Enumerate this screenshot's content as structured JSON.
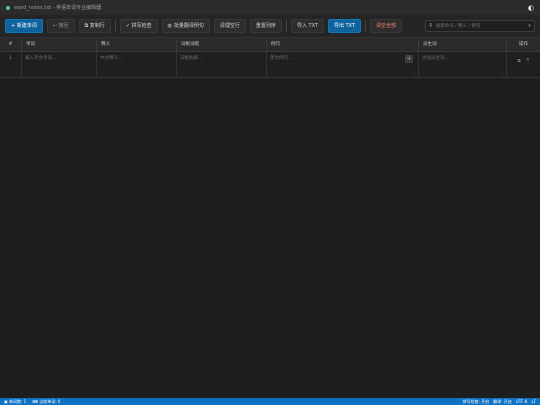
{
  "window": {
    "title": "word_notes.txt - 英语单词专业编辑器"
  },
  "toolbar": {
    "new_word": "+ 新建单词",
    "undo": "↩ 撤回",
    "copy_row": "⧉ 复制行",
    "spellcheck": "✓ 拼写检查",
    "batch_translate": "批量翻译例句",
    "clear_empty": "清理空行",
    "reorder": "重置列序",
    "import_txt": "导入 TXT",
    "export_txt": "导出 TXT",
    "clear_all": "清空全部"
  },
  "search": {
    "placeholder": "搜索单词 / 释义 / 例句",
    "clear": "x"
  },
  "table": {
    "headers": [
      "#",
      "单词",
      "释义",
      "词根词缀",
      "例句",
      "派生词",
      "操作"
    ],
    "rows": [
      {
        "num": "1",
        "word_placeholder": "输入英文单词…",
        "meaning_placeholder": "中文释义…",
        "root_placeholder": "词根拆解…",
        "example_placeholder": "英文例句…",
        "derived_placeholder": "添加派生词…",
        "example_btn": "译"
      }
    ]
  },
  "statusbar": {
    "word_count": "▣ 单词数: 1",
    "current": "⌨ 当前单词: 0",
    "right_items": [
      "拼写检查: 开启",
      "翻译: 开启",
      "UTF-8",
      "LF"
    ]
  }
}
